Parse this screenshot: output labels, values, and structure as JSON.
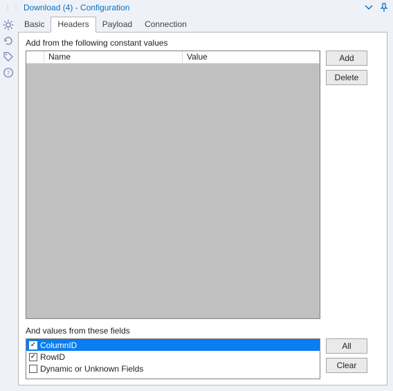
{
  "title": "Download (4) - Configuration",
  "tabs": {
    "basic": "Basic",
    "headers": "Headers",
    "payload": "Payload",
    "connection": "Connection",
    "active": "headers"
  },
  "sections": {
    "constants_label": "Add from the following constant values",
    "fields_label": "And values from these fields"
  },
  "table": {
    "col_name": "Name",
    "col_value": "Value"
  },
  "buttons": {
    "add": "Add",
    "delete": "Delete",
    "all": "All",
    "clear": "Clear"
  },
  "fields": [
    {
      "label": "ColumnID",
      "checked": true,
      "selected": true
    },
    {
      "label": "RowID",
      "checked": true,
      "selected": false
    },
    {
      "label": "Dynamic or Unknown Fields",
      "checked": false,
      "selected": false
    }
  ],
  "gutter_icons": [
    "gear",
    "refresh",
    "tag",
    "help"
  ],
  "title_icons": [
    "chevron-down",
    "pin"
  ]
}
